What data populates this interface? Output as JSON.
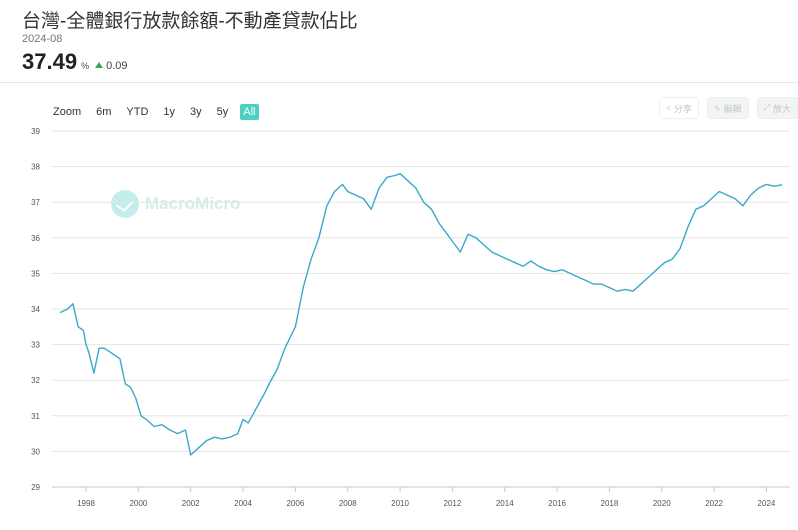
{
  "header": {
    "title": "台灣-全體銀行放款餘額-不動產貸款佔比",
    "date": "2024-08",
    "value": "37.49",
    "unit": "%",
    "change": "0.09"
  },
  "range_buttons": [
    {
      "label": "Zoom",
      "active": false
    },
    {
      "label": "6m",
      "active": false
    },
    {
      "label": "YTD",
      "active": false
    },
    {
      "label": "1y",
      "active": false
    },
    {
      "label": "3y",
      "active": false
    },
    {
      "label": "5y",
      "active": false
    },
    {
      "label": "All",
      "active": true
    }
  ],
  "tools": {
    "share_label": "分享",
    "edit_label": "編輯",
    "expand_label": "放大"
  },
  "watermark": "MacroMicro",
  "colors": {
    "line": "#3aa9c9",
    "accent": "#4dd0c4",
    "up": "#3aa757"
  },
  "chart_data": {
    "type": "line",
    "title": "台灣-全體銀行放款餘額-不動產貸款佔比",
    "xlabel": "",
    "ylabel": "",
    "ylim": [
      29,
      39
    ],
    "xlim": [
      1996.7,
      2024.9
    ],
    "y_ticks": [
      "29",
      "30",
      "31",
      "32",
      "33",
      "34",
      "35",
      "36",
      "37",
      "38",
      "39"
    ],
    "x_ticks": [
      "1998",
      "2000",
      "2002",
      "2004",
      "2006",
      "2008",
      "2010",
      "2012",
      "2014",
      "2016",
      "2018",
      "2020",
      "2022",
      "2024"
    ],
    "grid": true,
    "series": [
      {
        "x": [
          1997.0,
          1997.3,
          1997.5,
          1997.7,
          1997.9,
          1998.0,
          1998.1,
          1998.3,
          1998.5,
          1998.7,
          1998.9,
          1999.1,
          1999.3,
          1999.5,
          1999.7,
          1999.9,
          2000.1,
          2000.3,
          2000.6,
          2000.9,
          2001.2,
          2001.5,
          2001.8,
          2002.0,
          2002.3,
          2002.6,
          2002.9,
          2003.2,
          2003.5,
          2003.8,
          2004.0,
          2004.2,
          2004.5,
          2004.8,
          2005.0,
          2005.3,
          2005.6,
          2005.8,
          2006.0,
          2006.3,
          2006.6,
          2006.9,
          2007.2,
          2007.5,
          2007.8,
          2008.0,
          2008.3,
          2008.6,
          2008.9,
          2009.2,
          2009.5,
          2009.8,
          2010.0,
          2010.3,
          2010.6,
          2010.9,
          2011.2,
          2011.5,
          2011.8,
          2012.0,
          2012.3,
          2012.6,
          2012.9,
          2013.2,
          2013.5,
          2013.8,
          2014.1,
          2014.4,
          2014.7,
          2015.0,
          2015.3,
          2015.6,
          2015.9,
          2016.2,
          2016.5,
          2016.8,
          2017.1,
          2017.4,
          2017.7,
          2018.0,
          2018.3,
          2018.6,
          2018.9,
          2019.2,
          2019.5,
          2019.8,
          2020.1,
          2020.4,
          2020.7,
          2021.0,
          2021.3,
          2021.6,
          2021.9,
          2022.2,
          2022.5,
          2022.8,
          2023.1,
          2023.4,
          2023.7,
          2024.0,
          2024.3,
          2024.6
        ],
        "y": [
          33.9,
          34.0,
          34.15,
          33.5,
          33.4,
          33.0,
          32.8,
          32.2,
          32.9,
          32.9,
          32.8,
          32.7,
          32.6,
          31.9,
          31.8,
          31.5,
          31.0,
          30.9,
          30.7,
          30.75,
          30.6,
          30.5,
          30.6,
          29.9,
          30.1,
          30.3,
          30.4,
          30.35,
          30.4,
          30.5,
          30.9,
          30.8,
          31.2,
          31.6,
          31.9,
          32.3,
          32.9,
          33.2,
          33.5,
          34.6,
          35.4,
          36.0,
          36.9,
          37.3,
          37.5,
          37.3,
          37.2,
          37.1,
          36.8,
          37.4,
          37.7,
          37.75,
          37.8,
          37.6,
          37.4,
          37.0,
          36.8,
          36.4,
          36.1,
          35.9,
          35.6,
          36.1,
          36.0,
          35.8,
          35.6,
          35.5,
          35.4,
          35.3,
          35.2,
          35.35,
          35.2,
          35.1,
          35.05,
          35.1,
          35.0,
          34.9,
          34.8,
          34.7,
          34.7,
          34.6,
          34.5,
          34.55,
          34.5,
          34.7,
          34.9,
          35.1,
          35.3,
          35.4,
          35.7,
          36.3,
          36.8,
          36.9,
          37.1,
          37.3,
          37.2,
          37.1,
          36.9,
          37.2,
          37.4,
          37.5,
          37.45,
          37.49
        ]
      }
    ]
  }
}
